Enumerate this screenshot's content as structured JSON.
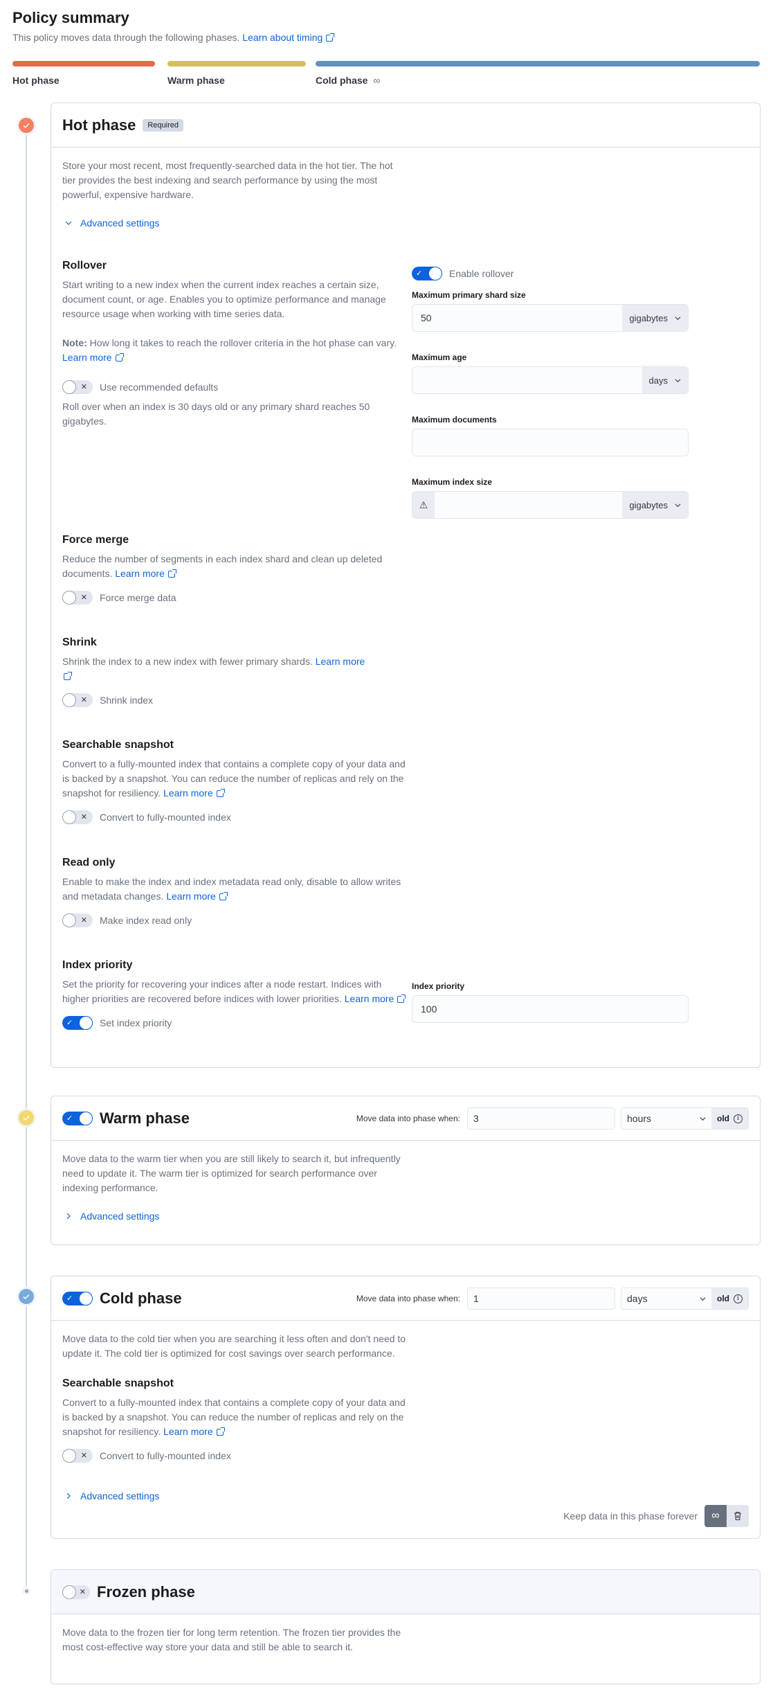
{
  "summary": {
    "title": "Policy summary",
    "subtitle": "This policy moves data through the following phases.",
    "learn_link": "Learn about timing",
    "phases": [
      {
        "label": "Hot phase",
        "color": "#e7664c"
      },
      {
        "label": "Warm phase",
        "color": "#d6bf57"
      },
      {
        "label": "Cold phase",
        "color": "#6092c0",
        "icon": "infinity-icon"
      }
    ]
  },
  "colors": {
    "hot": "#f6805f",
    "warm": "#f1d86f",
    "cold": "#79aad9",
    "accent": "#0b64dd"
  },
  "hot": {
    "title": "Hot phase",
    "badge": "Required",
    "description": "Store your most recent, most frequently-searched data in the hot tier. The hot tier provides the best indexing and search performance by using the most powerful, expensive hardware.",
    "advanced_label": "Advanced settings",
    "advanced_expanded": true,
    "rollover": {
      "title": "Rollover",
      "description": "Start writing to a new index when the current index reaches a certain size, document count, or age. Enables you to optimize performance and manage resource usage when working with time series data.",
      "note_label": "Note:",
      "note_text": "How long it takes to reach the rollover criteria in the hot phase can vary.",
      "learn_more": "Learn more",
      "defaults_label": "Use recommended defaults",
      "defaults_on": false,
      "defaults_text": "Roll over when an index is 30 days old or any primary shard reaches 50 gigabytes.",
      "enable_label": "Enable rollover",
      "enable_on": true,
      "fields": {
        "max_primary_shard_size": {
          "label": "Maximum primary shard size",
          "value": "50",
          "unit": "gigabytes"
        },
        "max_age": {
          "label": "Maximum age",
          "value": "",
          "unit": "days"
        },
        "max_docs": {
          "label": "Maximum documents",
          "value": ""
        },
        "max_index_size": {
          "label": "Maximum index size",
          "value": "",
          "unit": "gigabytes",
          "icon": "warning-icon"
        }
      }
    },
    "force_merge": {
      "title": "Force merge",
      "description": "Reduce the number of segments in each index shard and clean up deleted documents.",
      "learn_more": "Learn more",
      "toggle_label": "Force merge data",
      "on": false
    },
    "shrink": {
      "title": "Shrink",
      "description": "Shrink the index to a new index with fewer primary shards.",
      "learn_more": "Learn more",
      "toggle_label": "Shrink index",
      "on": false
    },
    "searchable_snapshot": {
      "title": "Searchable snapshot",
      "description": "Convert to a fully-mounted index that contains a complete copy of your data and is backed by a snapshot. You can reduce the number of replicas and rely on the snapshot for resiliency.",
      "learn_more": "Learn more",
      "toggle_label": "Convert to fully-mounted index",
      "on": false
    },
    "read_only": {
      "title": "Read only",
      "description": "Enable to make the index and index metadata read only, disable to allow writes and metadata changes.",
      "learn_more": "Learn more",
      "toggle_label": "Make index read only",
      "on": false
    },
    "index_priority": {
      "title": "Index priority",
      "description": "Set the priority for recovering your indices after a node restart. Indices with higher priorities are recovered before indices with lower priorities.",
      "learn_more": "Learn more",
      "toggle_label": "Set index priority",
      "on": true,
      "field_label": "Index priority",
      "value": "100"
    }
  },
  "warm": {
    "title": "Warm phase",
    "enabled": true,
    "timing_label": "Move data into phase when:",
    "timing_value": "3",
    "timing_unit": "hours",
    "timing_suffix": "old",
    "description": "Move data to the warm tier when you are still likely to search it, but infrequently need to update it. The warm tier is optimized for search performance over indexing performance.",
    "advanced_label": "Advanced settings",
    "advanced_expanded": false
  },
  "cold": {
    "title": "Cold phase",
    "enabled": true,
    "timing_label": "Move data into phase when:",
    "timing_value": "1",
    "timing_unit": "days",
    "timing_suffix": "old",
    "description": "Move data to the cold tier when you are searching it less often and don't need to update it. The cold tier is optimized for cost savings over search performance.",
    "searchable_snapshot": {
      "title": "Searchable snapshot",
      "description": "Convert to a fully-mounted index that contains a complete copy of your data and is backed by a snapshot. You can reduce the number of replicas and rely on the snapshot for resiliency.",
      "learn_more": "Learn more",
      "toggle_label": "Convert to fully-mounted index",
      "on": false
    },
    "advanced_label": "Advanced settings",
    "advanced_expanded": false,
    "keep_label": "Keep data in this phase forever"
  },
  "frozen": {
    "title": "Frozen phase",
    "enabled": false,
    "description": "Move data to the frozen tier for long term retention. The frozen tier provides the most cost-effective way store your data and still be able to search it."
  }
}
